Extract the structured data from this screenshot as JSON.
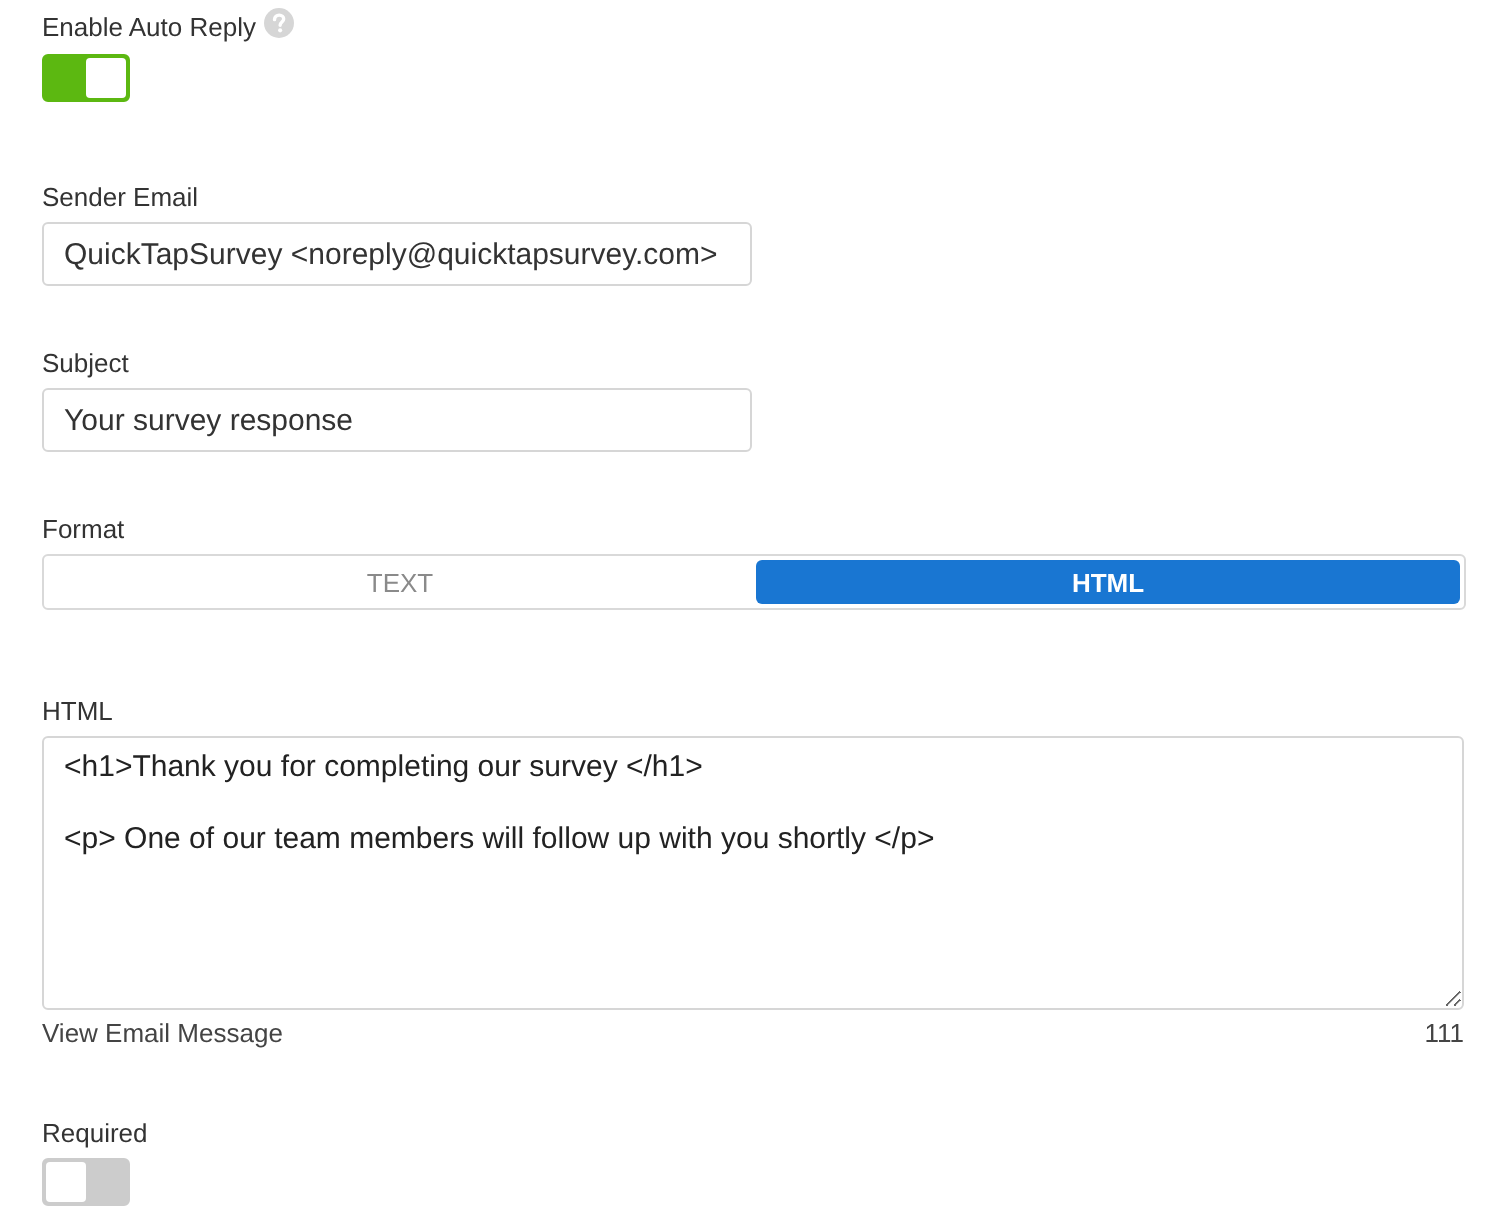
{
  "auto_reply": {
    "label": "Enable Auto Reply",
    "on": true
  },
  "fields": [
    {
      "label": "Sender Email",
      "value": "QuickTapSurvey <noreply@quicktapsurvey.com>"
    },
    {
      "label": "Subject",
      "value": "Your survey response"
    }
  ],
  "format": {
    "label": "Format",
    "options": [
      {
        "label": "TEXT",
        "selected": false
      },
      {
        "label": "HTML",
        "selected": true
      }
    ]
  },
  "html": {
    "label": "HTML",
    "value": "<h1>Thank you for completing our survey </h1>\n\n<p> One of our team members will follow up with you shortly </p>",
    "link": "View Email Message",
    "count": "111"
  },
  "required": {
    "label": "Required",
    "on": false
  }
}
